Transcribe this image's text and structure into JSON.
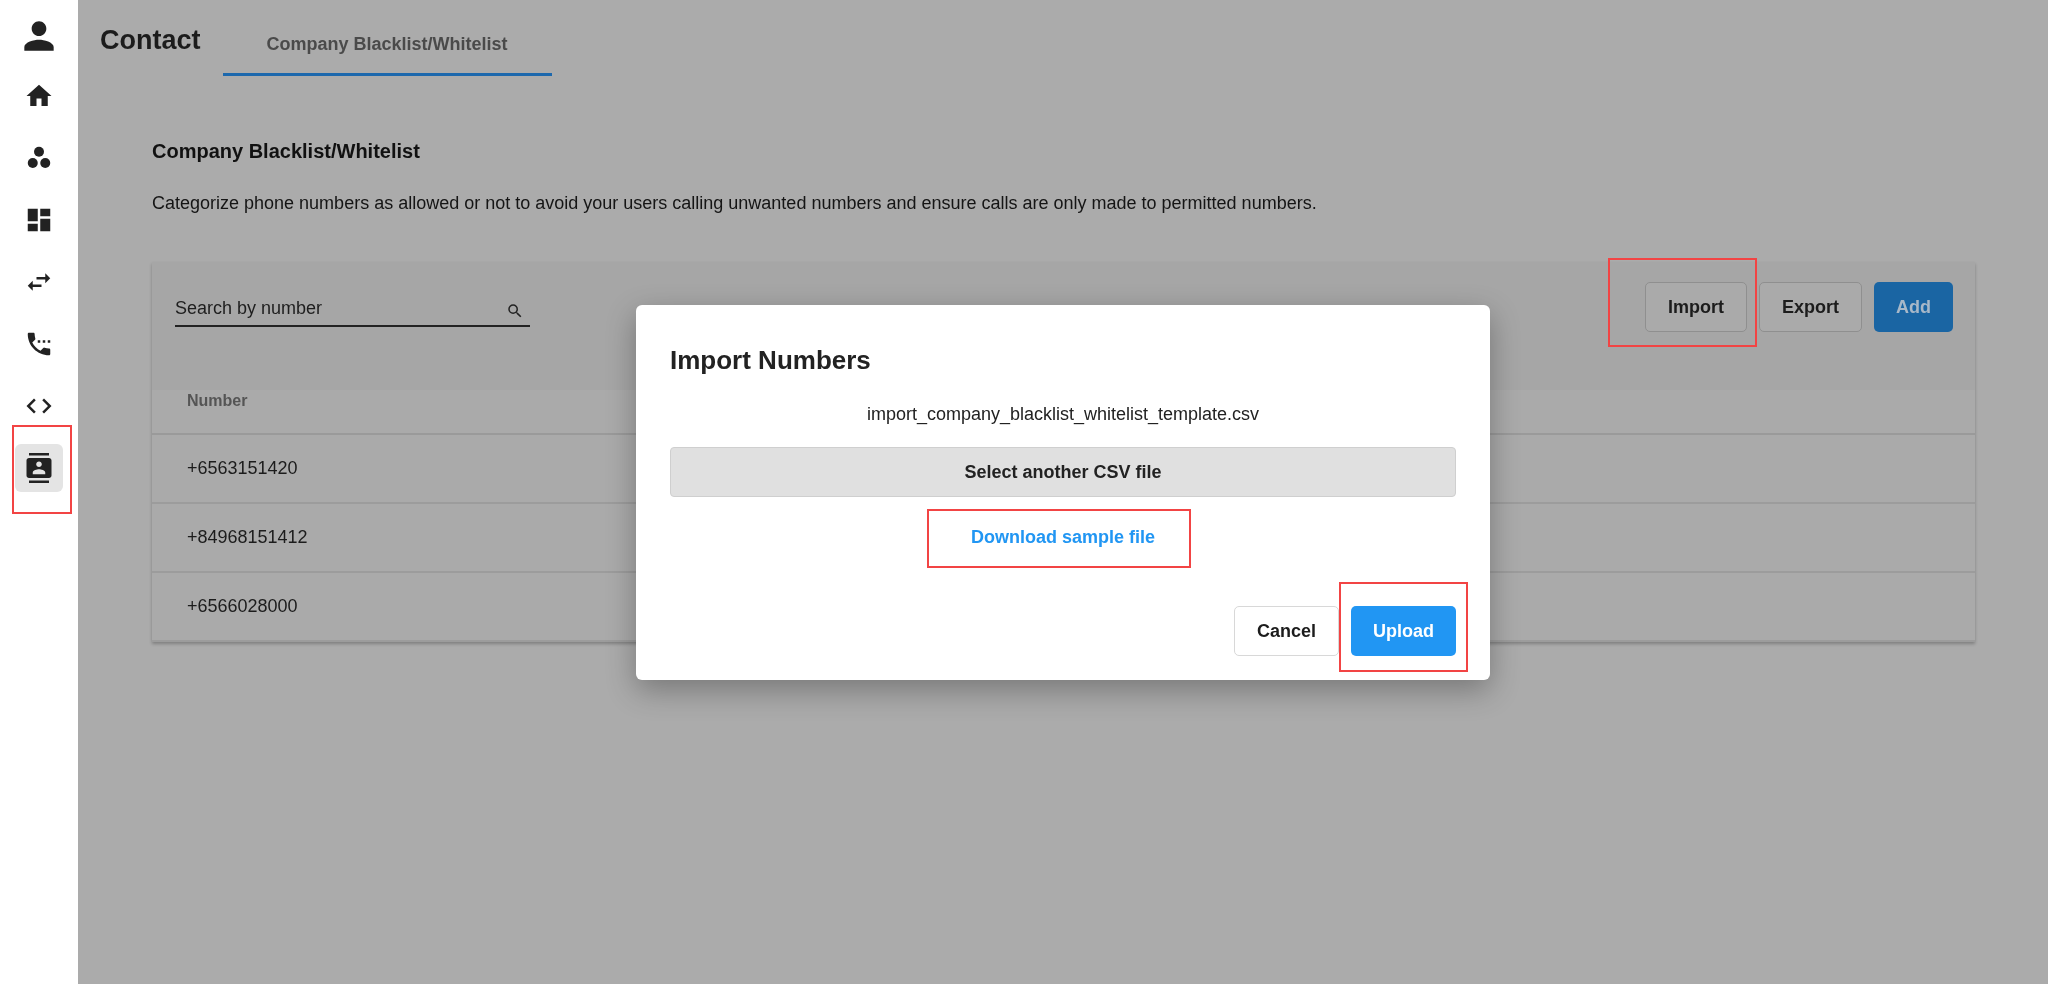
{
  "sidebar": {
    "items": [
      {
        "selected": false,
        "highlighted": false
      },
      {
        "selected": false,
        "highlighted": false
      },
      {
        "selected": false,
        "highlighted": false
      },
      {
        "selected": false,
        "highlighted": false
      },
      {
        "selected": false,
        "highlighted": false
      },
      {
        "selected": false,
        "highlighted": false
      },
      {
        "selected": true,
        "highlighted": true
      }
    ]
  },
  "header": {
    "title": "Contact",
    "tabs": [
      {
        "label": "Company Blacklist/Whitelist",
        "selected": true
      }
    ]
  },
  "section": {
    "title": "Company Blacklist/Whitelist",
    "description": "Categorize phone numbers as allowed or not to avoid your users calling unwanted numbers and ensure calls are only made to permitted numbers."
  },
  "toolbar": {
    "search": {
      "placeholder": "Search by number"
    },
    "buttons": [
      {
        "label": "Import",
        "kind": "outlined",
        "highlighted": true
      },
      {
        "label": "Export",
        "kind": "outlined",
        "highlighted": false
      },
      {
        "label": "Add",
        "kind": "primary",
        "highlighted": false
      }
    ]
  },
  "table": {
    "columns": [
      "Number"
    ],
    "rows": [
      [
        "+6563151420"
      ],
      [
        "+84968151412"
      ],
      [
        "+6566028000"
      ]
    ]
  },
  "dialog": {
    "title": "Import Numbers",
    "file_name": "import_company_blacklist_whitelist_template.csv",
    "select_button": "Select another CSV file",
    "download_link": {
      "label": "Download sample file",
      "highlighted": true
    },
    "buttons": [
      {
        "label": "Cancel",
        "kind": "outlined",
        "highlighted": false
      },
      {
        "label": "Upload",
        "kind": "primary",
        "highlighted": true
      }
    ]
  }
}
